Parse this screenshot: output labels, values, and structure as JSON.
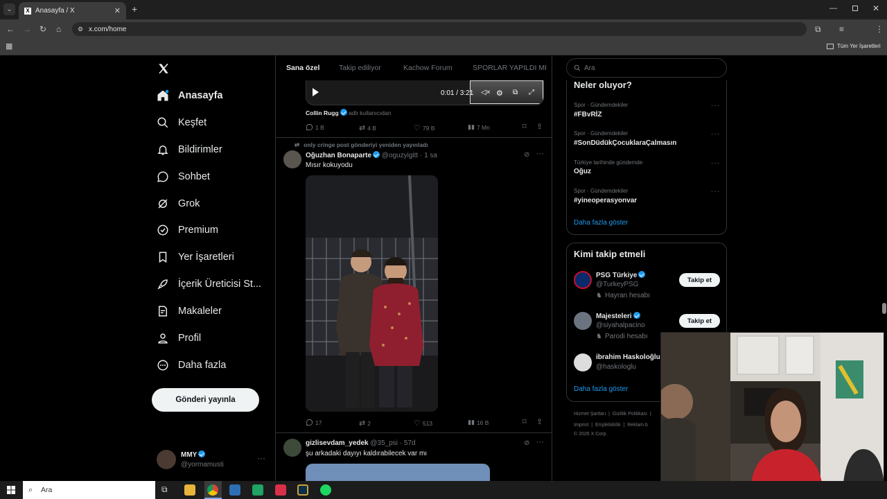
{
  "browser": {
    "tab_title": "Anasayfa / X",
    "url": "x.com/home",
    "bookmarks_label": "Tüm Yer İşaretleri"
  },
  "sidebar": {
    "items": [
      {
        "label": "Anasayfa",
        "icon": "home-icon"
      },
      {
        "label": "Keşfet",
        "icon": "search-icon"
      },
      {
        "label": "Bildirimler",
        "icon": "bell-icon"
      },
      {
        "label": "Sohbet",
        "icon": "chat-icon"
      },
      {
        "label": "Grok",
        "icon": "grok-icon"
      },
      {
        "label": "Premium",
        "icon": "verified-badge-icon"
      },
      {
        "label": "Yer İşaretleri",
        "icon": "bookmark-icon"
      },
      {
        "label": "İçerik Üreticisi St...",
        "icon": "rocket-icon"
      },
      {
        "label": "Makaleler",
        "icon": "article-icon"
      },
      {
        "label": "Profil",
        "icon": "person-icon"
      },
      {
        "label": "Daha fazla",
        "icon": "more-circle-icon"
      }
    ],
    "post_button": "Gönderi yayınla",
    "account": {
      "name": "MMY",
      "handle": "@yormamusti"
    }
  },
  "timeline": {
    "tabs": [
      "Sana özel",
      "Takip ediliyor",
      "Kachow Forum",
      "SPORLAR YAPILDI MI"
    ],
    "video": {
      "time": "0:01 / 3:21"
    },
    "post0": {
      "source_name": "Collin Rugg",
      "source_note": "adlı kullanıcıdan",
      "replies": "1 B",
      "reposts": "4 B",
      "likes": "79 B",
      "views": "7 Mn"
    },
    "post1": {
      "repost_note": "only cringe post gönderiyi yeniden yayınladı",
      "name": "Oğuzhan Bonaparte",
      "handle": "@oguzyigitt",
      "time": "· 1 sa",
      "text": "Mısır kokuyodu",
      "replies": "17",
      "reposts": "2",
      "likes": "513",
      "views": "16 B"
    },
    "post2": {
      "name": "gizlisevdam_yedek",
      "handle": "@35_psi",
      "time": "· 57d",
      "text": "şu arkadaki dayıyı kaldırabilecek var mı"
    }
  },
  "right": {
    "search_placeholder": "Ara",
    "trends_title": "Neler oluyor?",
    "trends": [
      {
        "category": "Spor · Gündemdekiler",
        "name": "#FBvRİZ"
      },
      {
        "category": "Spor · Gündemdekiler",
        "name": "#SonDüdükÇocuklaraÇalmasın"
      },
      {
        "category": "Türkiye tarihinde gündemde",
        "name": "Oğuz"
      },
      {
        "category": "Spor · Gündemdekiler",
        "name": "#yineoperasyonvar"
      }
    ],
    "trends_more": "Daha fazla göster",
    "who_title": "Kimi takip etmeli",
    "who": [
      {
        "name": "PSG Türkiye",
        "handle": "@TurkeyPSG",
        "note": "Hayran hesabı"
      },
      {
        "name": "Majesteleri",
        "handle": "@siyahalpacino",
        "note": "Parodi hesabı"
      },
      {
        "name": "ibrahim Haskoloğlu",
        "handle": "@haskologlu",
        "note": ""
      }
    ],
    "follow_label": "Takip et",
    "who_more": "Daha fazla göster",
    "footer": {
      "terms": "Hizmet Şartları",
      "privacy": "Gizlilik Politikası",
      "imprint": "Imprint",
      "access": "Erişilebilirlik",
      "ads": "Reklam b",
      "copyright": "© 2026 X Corp."
    }
  },
  "taskbar": {
    "search": "Ara"
  }
}
